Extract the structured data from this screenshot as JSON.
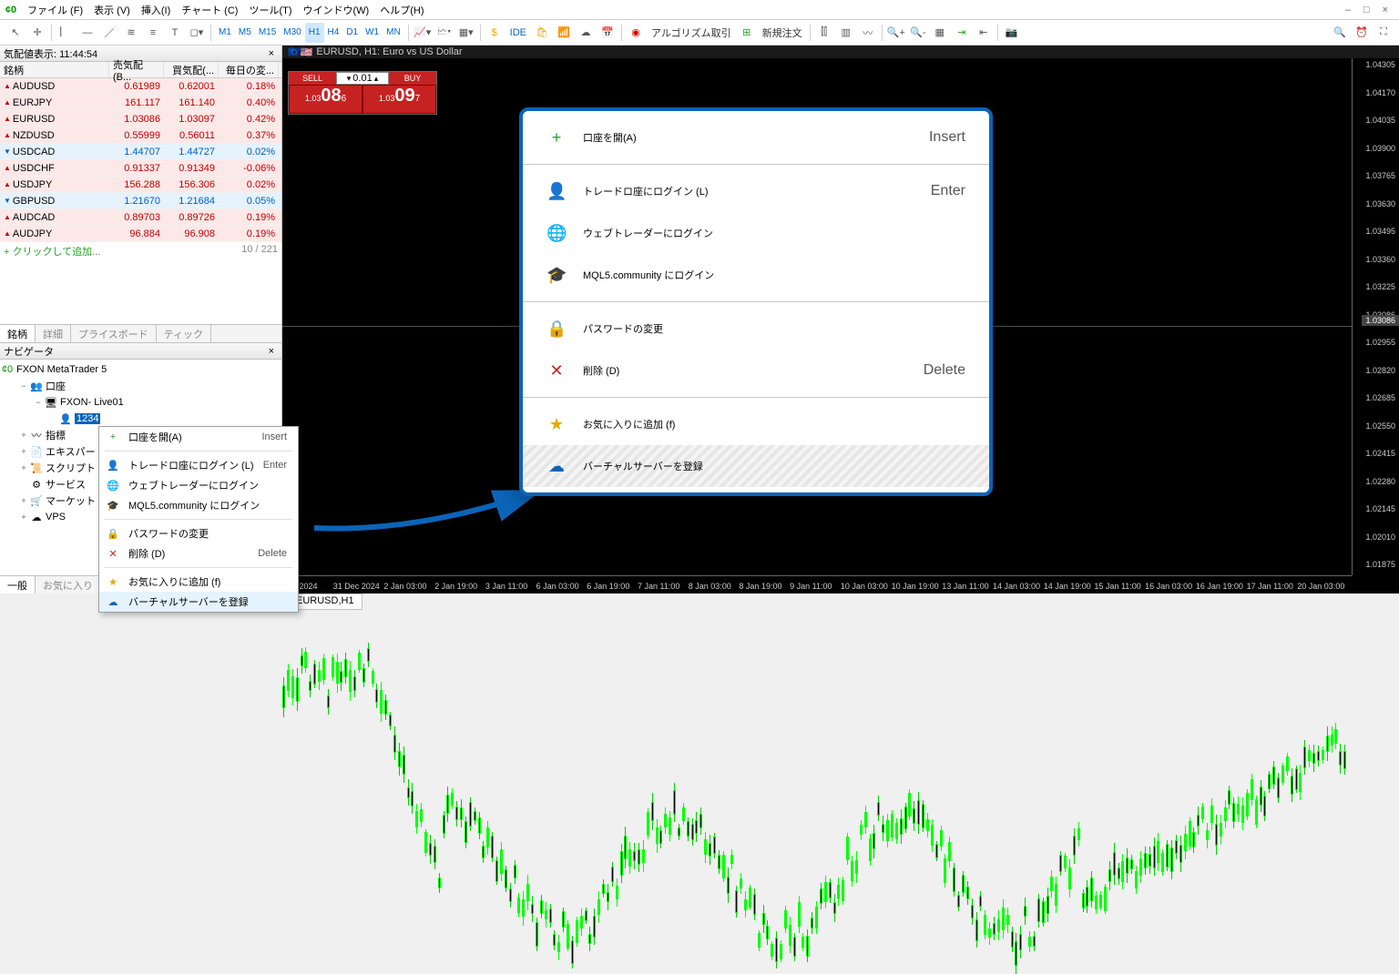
{
  "menu": [
    "ファイル (F)",
    "表示 (V)",
    "挿入(I)",
    "チャート (C)",
    "ツール(T)",
    "ウインドウ(W)",
    "ヘルプ(H)"
  ],
  "winctrl": [
    "–",
    "□",
    "×"
  ],
  "timeframes": [
    "M1",
    "M5",
    "M15",
    "M30",
    "H1",
    "H4",
    "D1",
    "W1",
    "MN"
  ],
  "tool_algo": "アルゴリズム取引",
  "tool_neworder": "新規注文",
  "tool_ide": "IDE",
  "marketwatch": {
    "title": "気配値表示: 11:44:54",
    "cols": [
      "銘柄",
      "売気配(B...",
      "買気配(...",
      "毎日の変..."
    ],
    "rows": [
      {
        "dir": "up",
        "sym": "AUDUSD",
        "bid": "0.61989",
        "ask": "0.62001",
        "chg": "0.18%",
        "cc": "t-up"
      },
      {
        "dir": "up",
        "sym": "EURJPY",
        "bid": "161.117",
        "ask": "161.140",
        "chg": "0.40%",
        "cc": "t-up"
      },
      {
        "dir": "up",
        "sym": "EURUSD",
        "bid": "1.03086",
        "ask": "1.03097",
        "chg": "0.42%",
        "cc": "t-up"
      },
      {
        "dir": "up",
        "sym": "NZDUSD",
        "bid": "0.55999",
        "ask": "0.56011",
        "chg": "0.37%",
        "cc": "t-up"
      },
      {
        "dir": "dn",
        "sym": "USDCAD",
        "bid": "1.44707",
        "ask": "1.44727",
        "chg": "0.02%",
        "cc": "t-dn"
      },
      {
        "dir": "up",
        "sym": "USDCHF",
        "bid": "0.91337",
        "ask": "0.91349",
        "chg": "-0.06%",
        "cc": "t-up"
      },
      {
        "dir": "up",
        "sym": "USDJPY",
        "bid": "156.288",
        "ask": "156.306",
        "chg": "0.02%",
        "cc": "t-up"
      },
      {
        "dir": "dn",
        "sym": "GBPUSD",
        "bid": "1.21670",
        "ask": "1.21684",
        "chg": "0.05%",
        "cc": "t-dn"
      },
      {
        "dir": "up",
        "sym": "AUDCAD",
        "bid": "0.89703",
        "ask": "0.89726",
        "chg": "0.19%",
        "cc": "t-up"
      },
      {
        "dir": "up",
        "sym": "AUDJPY",
        "bid": "96.884",
        "ask": "96.908",
        "chg": "0.19%",
        "cc": "t-up"
      }
    ],
    "add": "クリックして追加...",
    "count": "10 / 221",
    "tabs": [
      "銘柄",
      "詳細",
      "プライスボード",
      "ティック"
    ]
  },
  "navigator": {
    "title": "ナビゲータ",
    "root": "FXON MetaTrader 5",
    "items": [
      {
        "ind": 1,
        "exp": "−",
        "ico": "👥",
        "lbl": "口座"
      },
      {
        "ind": 2,
        "exp": "−",
        "ico": "🖥",
        "lbl": "FXON- Live01"
      },
      {
        "ind": 3,
        "exp": "",
        "ico": "👤",
        "lbl": "1234",
        "sel": true
      },
      {
        "ind": 1,
        "exp": "+",
        "ico": "〰",
        "lbl": "指標"
      },
      {
        "ind": 1,
        "exp": "+",
        "ico": "📄",
        "lbl": "エキスパートア"
      },
      {
        "ind": 1,
        "exp": "+",
        "ico": "📜",
        "lbl": "スクリプト"
      },
      {
        "ind": 1,
        "exp": "",
        "ico": "⚙",
        "lbl": "サービス"
      },
      {
        "ind": 1,
        "exp": "+",
        "ico": "🛒",
        "lbl": "マーケット"
      },
      {
        "ind": 1,
        "exp": "+",
        "ico": "☁",
        "lbl": "VPS"
      }
    ],
    "tabs": [
      "一般",
      "お気に入り"
    ]
  },
  "ctx_small": [
    {
      "t": "item",
      "ico": "+",
      "lbl": "口座を開(A)",
      "sh": "Insert",
      "col": "#2a9d2a"
    },
    {
      "t": "sep"
    },
    {
      "t": "item",
      "ico": "👤",
      "lbl": "トレードロ座にログイン (L)",
      "sh": "Enter",
      "col": "#0b64b8"
    },
    {
      "t": "item",
      "ico": "🌐",
      "lbl": "ウェブトレーダーにログイン",
      "col": "#0b64b8"
    },
    {
      "t": "item",
      "ico": "🎓",
      "lbl": "MQL5.community にログイン",
      "col": "#0b64b8"
    },
    {
      "t": "sep"
    },
    {
      "t": "item",
      "ico": "🔒",
      "lbl": "パスワードの変更",
      "col": "#0b64b8"
    },
    {
      "t": "item",
      "ico": "✕",
      "lbl": "削除 (D)",
      "sh": "Delete",
      "col": "#c62222"
    },
    {
      "t": "sep"
    },
    {
      "t": "item",
      "ico": "★",
      "lbl": "お気に入りに追加 (f)",
      "col": "#e6a800"
    },
    {
      "t": "item",
      "ico": "☁",
      "lbl": "バーチャルサーバーを登録",
      "col": "#0b64b8",
      "hl": true
    }
  ],
  "overlay": [
    {
      "t": "item",
      "ico": "+",
      "lbl": "口座を開(A)",
      "sh": "Insert",
      "col": "#2a9d2a"
    },
    {
      "t": "sep"
    },
    {
      "t": "item",
      "ico": "👤",
      "lbl": "トレードロ座にログイン (L)",
      "sh": "Enter",
      "col": "#0b64b8"
    },
    {
      "t": "item",
      "ico": "🌐",
      "lbl": "ウェブトレーダーにログイン",
      "col": "#0b64b8"
    },
    {
      "t": "item",
      "ico": "🎓",
      "lbl": "MQL5.community にログイン",
      "col": "#0b64b8"
    },
    {
      "t": "sep"
    },
    {
      "t": "item",
      "ico": "🔒",
      "lbl": "パスワードの変更",
      "col": "#0b64b8"
    },
    {
      "t": "item",
      "ico": "✕",
      "lbl": "削除 (D)",
      "sh": "Delete",
      "col": "#c62222"
    },
    {
      "t": "sep"
    },
    {
      "t": "item",
      "ico": "★",
      "lbl": "お気に入りに追加 (f)",
      "col": "#e6a800"
    },
    {
      "t": "item",
      "ico": "☁",
      "lbl": "バーチャルサーバーを登録",
      "col": "#0b64b8",
      "hl": true
    }
  ],
  "chart": {
    "title": "EURUSD, H1:  Euro vs US Dollar",
    "tab": "EURUSD,H1",
    "ticket": {
      "sell": "SELL",
      "buy": "BUY",
      "vol": "0.01",
      "p1": "1.03",
      "p2a": "08",
      "p3a": "6",
      "p2b": "09",
      "p3b": "7"
    },
    "ylabels": [
      "1.04305",
      "1.04170",
      "1.04035",
      "1.03900",
      "1.03765",
      "1.03630",
      "1.03495",
      "1.03360",
      "1.03225",
      "1.03086",
      "1.02955",
      "1.02820",
      "1.02685",
      "1.02550",
      "1.02415",
      "1.02280",
      "1.02145",
      "1.02010",
      "1.01875"
    ],
    "price_tag": "1.03086",
    "xlabels": [
      "Dec 2024",
      "31 Dec 2024",
      "2 Jan 03:00",
      "2 Jan 19:00",
      "3 Jan 11:00",
      "6 Jan 03:00",
      "6 Jan 19:00",
      "7 Jan 11:00",
      "8 Jan 03:00",
      "8 Jan 19:00",
      "9 Jan 11:00",
      "10 Jan 03:00",
      "10 Jan 19:00",
      "13 Jan 11:00",
      "14 Jan 03:00",
      "14 Jan 19:00",
      "15 Jan 11:00",
      "16 Jan 03:00",
      "16 Jan 19:00",
      "17 Jan 11:00",
      "20 Jan 03:00"
    ]
  }
}
